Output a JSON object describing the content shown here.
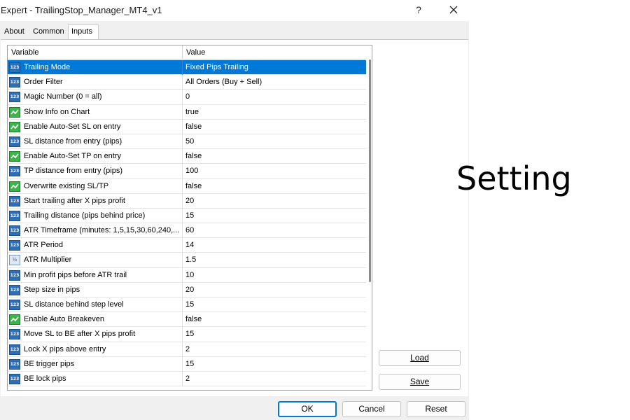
{
  "window": {
    "title": "Expert - TrailingStop_Manager_MT4_v1",
    "help_label": "?"
  },
  "tabs": [
    {
      "label": "About"
    },
    {
      "label": "Common"
    },
    {
      "label": "Inputs"
    }
  ],
  "active_tab": "Inputs",
  "grid": {
    "headers": {
      "variable": "Variable",
      "value": "Value"
    },
    "selected_row": 0,
    "rows": [
      {
        "icon": "integer-icon",
        "variable": "Trailing Mode",
        "value": "Fixed Pips Trailing"
      },
      {
        "icon": "integer-icon",
        "variable": "Order Filter",
        "value": "All Orders (Buy + Sell)"
      },
      {
        "icon": "integer-icon",
        "variable": "Magic Number (0 = all)",
        "value": "0"
      },
      {
        "icon": "boolean-icon",
        "variable": "Show Info on Chart",
        "value": "true"
      },
      {
        "icon": "boolean-icon",
        "variable": "Enable Auto-Set SL on entry",
        "value": "false"
      },
      {
        "icon": "integer-icon",
        "variable": "SL distance from entry (pips)",
        "value": "50"
      },
      {
        "icon": "boolean-icon",
        "variable": "Enable Auto-Set TP on entry",
        "value": "false"
      },
      {
        "icon": "integer-icon",
        "variable": "TP distance from entry (pips)",
        "value": "100"
      },
      {
        "icon": "boolean-icon",
        "variable": "Overwrite existing SL/TP",
        "value": "false"
      },
      {
        "icon": "integer-icon",
        "variable": "Start trailing after X pips profit",
        "value": "20"
      },
      {
        "icon": "integer-icon",
        "variable": "Trailing distance (pips behind price)",
        "value": "15"
      },
      {
        "icon": "integer-icon",
        "variable": "ATR Timeframe (minutes: 1,5,15,30,60,240,...",
        "value": "60"
      },
      {
        "icon": "integer-icon",
        "variable": "ATR Period",
        "value": "14"
      },
      {
        "icon": "double-icon",
        "variable": "ATR Multiplier",
        "value": "1.5"
      },
      {
        "icon": "integer-icon",
        "variable": "Min profit pips before ATR trail",
        "value": "10"
      },
      {
        "icon": "integer-icon",
        "variable": "Step size in pips",
        "value": "20"
      },
      {
        "icon": "integer-icon",
        "variable": "SL distance behind step level",
        "value": "15"
      },
      {
        "icon": "boolean-icon",
        "variable": "Enable Auto Breakeven",
        "value": "false"
      },
      {
        "icon": "integer-icon",
        "variable": "Move SL to BE after X pips profit",
        "value": "15"
      },
      {
        "icon": "integer-icon",
        "variable": "Lock X pips above entry",
        "value": "2"
      },
      {
        "icon": "integer-icon",
        "variable": "BE trigger pips",
        "value": "15"
      },
      {
        "icon": "integer-icon",
        "variable": "BE lock pips",
        "value": "2"
      }
    ]
  },
  "icon_glyphs": {
    "integer": "123",
    "double": "½"
  },
  "side_buttons": {
    "load": "Load",
    "save": "Save"
  },
  "dialog_buttons": {
    "ok": "OK",
    "cancel": "Cancel",
    "reset": "Reset"
  },
  "caption": "Setting",
  "colors": {
    "selection": "#0078d7",
    "integer_icon": "#2f6db5",
    "boolean_icon": "#3bb54a"
  }
}
